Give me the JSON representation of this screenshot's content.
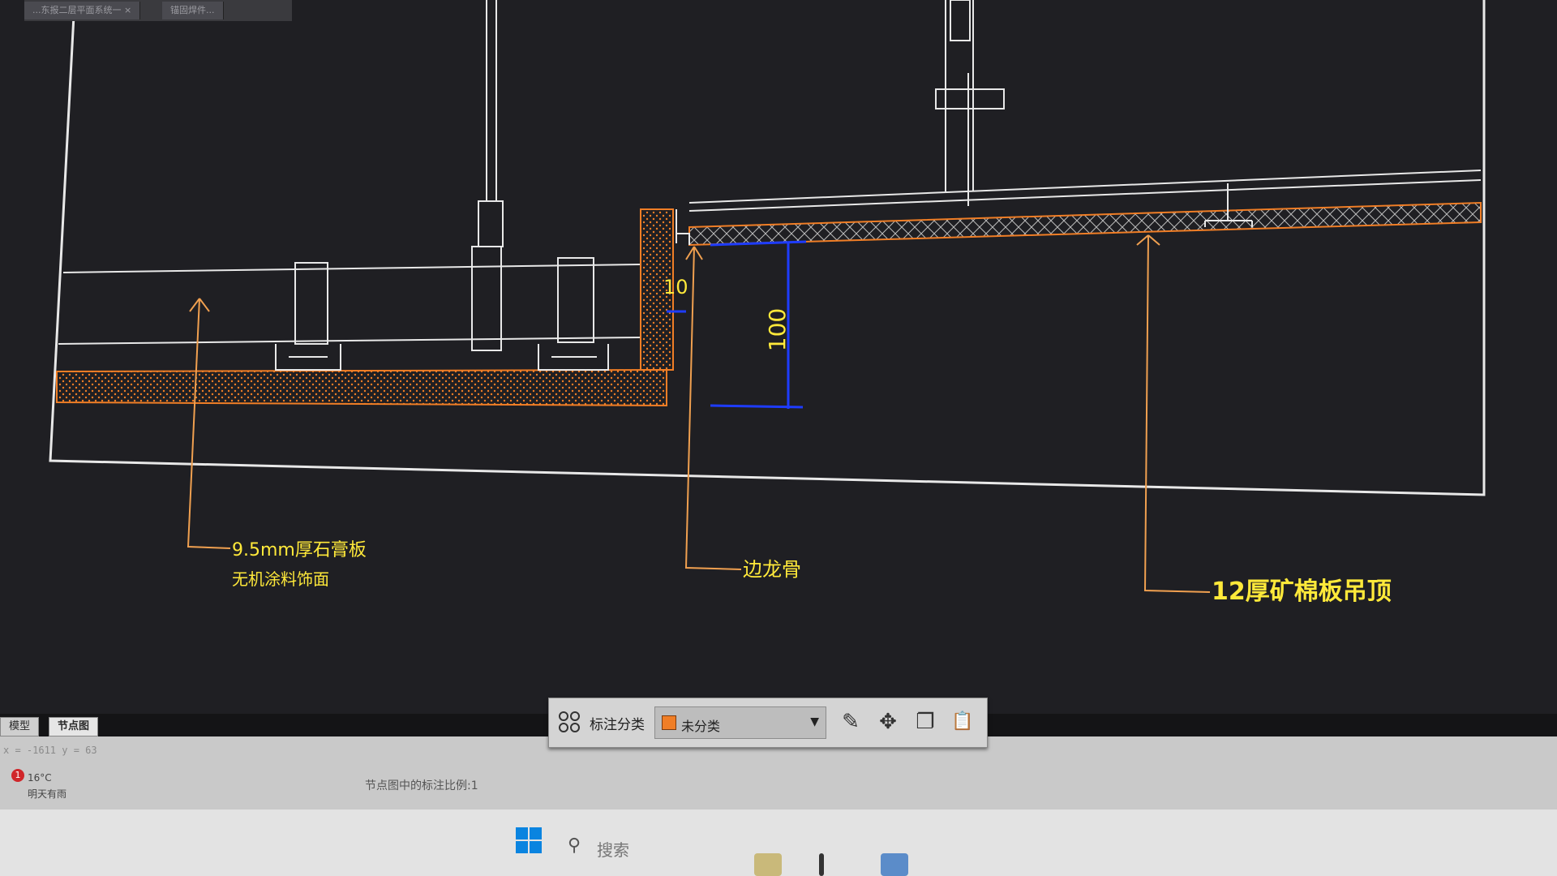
{
  "top_tabs": [
    {
      "label": "...东报二层平面系统一 ×"
    },
    {
      "label": "锚固焊件..."
    }
  ],
  "drawing": {
    "dimensions": [
      {
        "id": "gap",
        "text": "10"
      },
      {
        "id": "drop",
        "text": "100"
      }
    ],
    "annotations": [
      {
        "id": "gypsum",
        "lines": [
          "9.5mm厚石膏板",
          "无机涂料饰面"
        ]
      },
      {
        "id": "edge-keel",
        "lines": [
          "边龙骨"
        ]
      },
      {
        "id": "mineral-board",
        "lines": [
          "12厚矿棉板吊顶"
        ]
      }
    ],
    "colors": {
      "linework": "#e8e8e8",
      "section": "#f07e26",
      "dimension": "#1e3cff",
      "text": "#ffe93a",
      "leader": "#f0a050"
    }
  },
  "layout_tabs": [
    "模型",
    "节点图"
  ],
  "coordinates": "x = -1611  y = 63",
  "status": {
    "scale_note": "节点图中的标注比例:1",
    "weather": {
      "badge": "1",
      "temp": "16°C",
      "desc": "明天有雨"
    }
  },
  "toolbar": {
    "grid_icon": "grid-icon",
    "label": "标注分类",
    "select_value": "未分类",
    "select_swatch": "#f07e26",
    "buttons": [
      {
        "name": "edit-icon",
        "glyph": "✎"
      },
      {
        "name": "move-icon",
        "glyph": "✥"
      },
      {
        "name": "copy-icon",
        "glyph": "❐"
      },
      {
        "name": "paste-icon",
        "glyph": "📋"
      }
    ]
  },
  "taskbar": {
    "search_placeholder": "搜索"
  }
}
